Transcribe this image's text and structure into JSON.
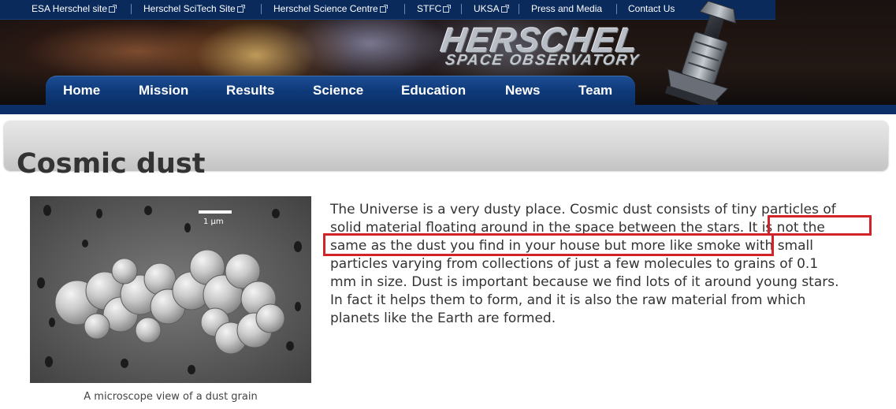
{
  "topbar": {
    "links": [
      {
        "label": "ESA Herschel site",
        "external": true
      },
      {
        "label": "Herschel SciTech Site",
        "external": true
      },
      {
        "label": "Herschel Science Centre",
        "external": true
      },
      {
        "label": "STFC",
        "external": true
      },
      {
        "label": "UKSA",
        "external": true
      },
      {
        "label": "Press and Media",
        "external": false
      },
      {
        "label": "Contact Us",
        "external": false
      }
    ],
    "background": "#0a2a5c"
  },
  "logo": {
    "main": "HERSCHEL",
    "sub": "SPACE OBSERVATORY"
  },
  "nav": {
    "items": [
      {
        "label": "Home"
      },
      {
        "label": "Mission"
      },
      {
        "label": "Results"
      },
      {
        "label": "Science"
      },
      {
        "label": "Education"
      },
      {
        "label": "News"
      },
      {
        "label": "Team"
      }
    ],
    "background": "#0f3a7a"
  },
  "page": {
    "title": "Cosmic dust"
  },
  "figure": {
    "scale_label": "1 μm",
    "caption": "A microscope view of a dust grain"
  },
  "article": {
    "lines": [
      "The Universe is a very dusty place. Cosmic dust consists of tiny particles of",
      "solid material floating around in the space between the stars. It is not the",
      "same as the dust you find in your house but more like smoke with small",
      "particles varying from collections of just a few molecules to grains of 0.1",
      "mm in size. Dust is important because we find lots of it around young stars.",
      "In fact it helps them to form, and it is also the raw material from which",
      "planets like the Earth are formed."
    ],
    "highlight_color": "#d2232a"
  },
  "icons": {
    "external_link": "external-link-icon",
    "telescope": "herschel-telescope-icon"
  }
}
